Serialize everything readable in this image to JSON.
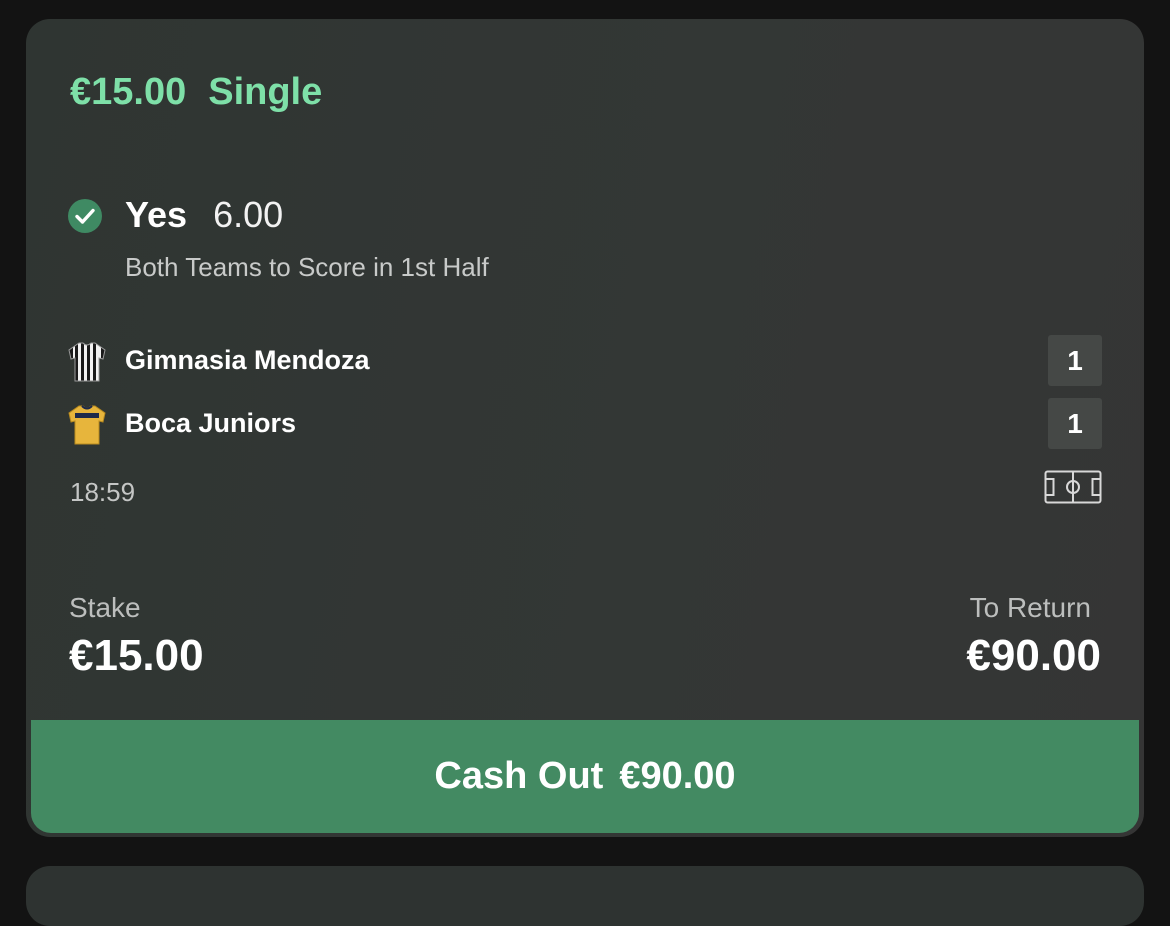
{
  "bet": {
    "stake_display": "€15.00",
    "type": "Single"
  },
  "selection": {
    "name": "Yes",
    "odds": "6.00",
    "market": "Both Teams to Score in 1st Half",
    "status_icon": "check-circle-icon",
    "status_color": "#3f8a63"
  },
  "match": {
    "teams": [
      {
        "name": "Gimnasia Mendoza",
        "score": "1",
        "kit_icon": "striped-black-white-shirt-icon"
      },
      {
        "name": "Boca Juniors",
        "score": "1",
        "kit_icon": "yellow-shirt-icon"
      }
    ],
    "time": "18:59",
    "pitch_icon": "pitch-icon"
  },
  "summary": {
    "stake_label": "Stake",
    "stake_value": "€15.00",
    "return_label": "To Return",
    "return_value": "€90.00"
  },
  "cashout": {
    "label": "Cash Out",
    "amount": "€90.00"
  },
  "colors": {
    "accent_green": "#7ee0a8",
    "button_green": "#438a62",
    "card_bg": "#313633"
  }
}
